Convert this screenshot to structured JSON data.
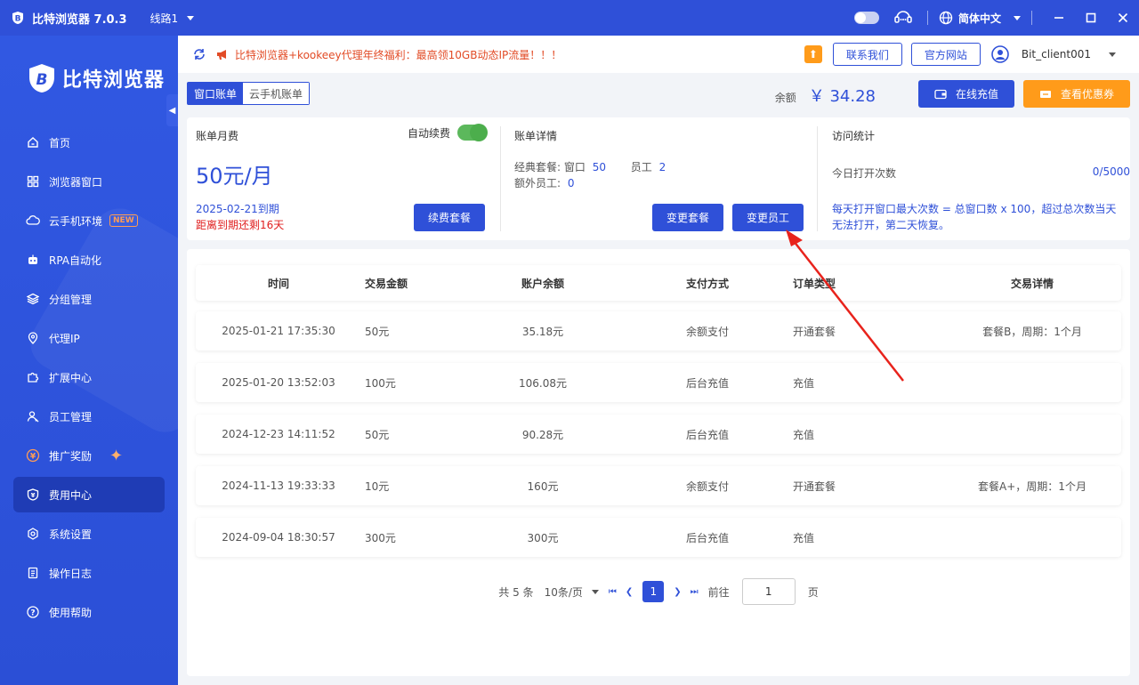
{
  "app": {
    "title": "比特浏览器 7.0.3",
    "line": "线路1",
    "language": "简体中文"
  },
  "sidebar": {
    "brand": "比特浏览器",
    "items": [
      {
        "label": "首页",
        "icon": "home-icon"
      },
      {
        "label": "浏览器窗口",
        "icon": "grid-icon"
      },
      {
        "label": "云手机环境",
        "icon": "cloud-icon",
        "badge": "NEW"
      },
      {
        "label": "RPA自动化",
        "icon": "robot-icon"
      },
      {
        "label": "分组管理",
        "icon": "layers-icon"
      },
      {
        "label": "代理IP",
        "icon": "location-icon"
      },
      {
        "label": "扩展中心",
        "icon": "puzzle-icon"
      },
      {
        "label": "员工管理",
        "icon": "users-icon"
      },
      {
        "label": "推广奖励",
        "icon": "yen-coin-icon"
      },
      {
        "label": "费用中心",
        "icon": "shield-icon",
        "active": true
      },
      {
        "label": "系统设置",
        "icon": "gear-icon"
      },
      {
        "label": "操作日志",
        "icon": "log-icon"
      },
      {
        "label": "使用帮助",
        "icon": "help-icon"
      }
    ]
  },
  "topbar": {
    "notice": "比特浏览器+kookeey代理年终福利：最高领10GB动态IP流量！！！",
    "contact": "联系我们",
    "website": "官方网站",
    "username": "Bit_client001"
  },
  "tabs": [
    "窗口账单",
    "云手机账单"
  ],
  "balance": {
    "label": "余额",
    "value": "￥ 34.28"
  },
  "buttons": {
    "recharge": "在线充值",
    "coupon": "查看优惠券",
    "renew": "续费套餐",
    "change_plan": "变更套餐",
    "change_staff": "变更员工"
  },
  "monthly": {
    "title": "账单月费",
    "auto_renew": "自动续费",
    "price": "50元/月",
    "expire": "2025-02-21到期",
    "remaining": "距离到期还剩16天"
  },
  "details": {
    "title": "账单详情",
    "plan_label": "经典套餐: 窗口",
    "plan_windows": "50",
    "staff_label": "员工",
    "staff_count": "2",
    "extra_label": "额外员工:",
    "extra_count": "0"
  },
  "visits": {
    "title": "访问统计",
    "today_label": "今日打开次数",
    "today_value": "0/5000",
    "note": "每天打开窗口最大次数 = 总窗口数 x 100，超过总次数当天无法打开，第二天恢复。"
  },
  "table": {
    "headers": [
      "时间",
      "交易金额",
      "账户余额",
      "支付方式",
      "订单类型",
      "交易详情"
    ],
    "rows": [
      [
        "2025-01-21 17:35:30",
        "50元",
        "35.18元",
        "余额支付",
        "开通套餐",
        "套餐B，周期：1个月"
      ],
      [
        "2025-01-20 13:52:03",
        "100元",
        "106.08元",
        "后台充值",
        "充值",
        ""
      ],
      [
        "2024-12-23 14:11:52",
        "50元",
        "90.28元",
        "后台充值",
        "充值",
        ""
      ],
      [
        "2024-11-13 19:33:33",
        "10元",
        "160元",
        "余额支付",
        "开通套餐",
        "套餐A+，周期：1个月"
      ],
      [
        "2024-09-04 18:30:57",
        "300元",
        "300元",
        "后台充值",
        "充值",
        ""
      ]
    ]
  },
  "pager": {
    "total": "共 5 条",
    "size": "10条/页",
    "current": "1",
    "goto": "前往",
    "goto_value": "1",
    "page_unit": "页"
  },
  "colors": {
    "primary": "#2f50d8",
    "orange": "#ff9b1a",
    "red": "#e02020",
    "switch": "#5cb85c"
  }
}
